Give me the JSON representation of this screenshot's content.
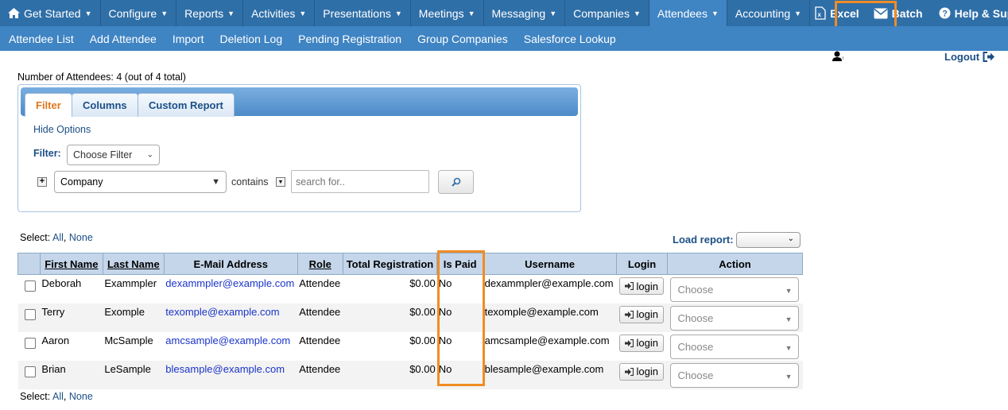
{
  "topnav": {
    "items": [
      {
        "label": "Get Started"
      },
      {
        "label": "Configure"
      },
      {
        "label": "Reports"
      },
      {
        "label": "Activities"
      },
      {
        "label": "Presentations"
      },
      {
        "label": "Meetings"
      },
      {
        "label": "Messaging"
      },
      {
        "label": "Companies"
      },
      {
        "label": "Attendees"
      },
      {
        "label": "Accounting"
      }
    ],
    "excel": "Excel",
    "batch": "Batch",
    "help": "Help & Support"
  },
  "subnav": [
    "Attendee List",
    "Add Attendee",
    "Import",
    "Deletion Log",
    "Pending Registration",
    "Group Companies",
    "Salesforce Lookup"
  ],
  "user": {
    "logout": "Logout"
  },
  "summary": "Number of Attendees: 4 (out of 4 total)",
  "filter_panel": {
    "tabs": [
      "Filter",
      "Columns",
      "Custom Report"
    ],
    "hide_options": "Hide Options",
    "filter_label": "Filter:",
    "choose_filter": "Choose Filter",
    "field": "Company",
    "operator": "contains",
    "search_placeholder": "search for.."
  },
  "select_all": {
    "label": "Select:",
    "all": "All",
    "none": "None",
    "sep": ","
  },
  "load_report": "Load report:",
  "table": {
    "headers": [
      "First Name",
      "Last Name",
      "E-Mail Address",
      "Role",
      "Total Registration",
      "Is Paid",
      "Username",
      "Login",
      "Action"
    ],
    "rows": [
      {
        "first": "Deborah",
        "last": "Exammpler",
        "email": "dexammpler@example.com",
        "role": "Attendee",
        "total": "$0.00",
        "paid": "No",
        "username": "dexammpler@example.com",
        "login": "login",
        "action": "Choose"
      },
      {
        "first": "Terry",
        "last": "Exomple",
        "email": "texomple@example.com",
        "role": "Attendee",
        "total": "$0.00",
        "paid": "No",
        "username": "texomple@example.com",
        "login": "login",
        "action": "Choose"
      },
      {
        "first": "Aaron",
        "last": "McSample",
        "email": "amcsample@example.com",
        "role": "Attendee",
        "total": "$0.00",
        "paid": "No",
        "username": "amcsample@example.com",
        "login": "login",
        "action": "Choose"
      },
      {
        "first": "Brian",
        "last": "LeSample",
        "email": "blesample@example.com",
        "role": "Attendee",
        "total": "$0.00",
        "paid": "No",
        "username": "blesample@example.com",
        "login": "login",
        "action": "Choose"
      }
    ]
  },
  "colors": {
    "nav": "#2f6fa8",
    "subnav": "#3f84c3",
    "highlight": "#f08c24",
    "link": "#1b4f86"
  }
}
